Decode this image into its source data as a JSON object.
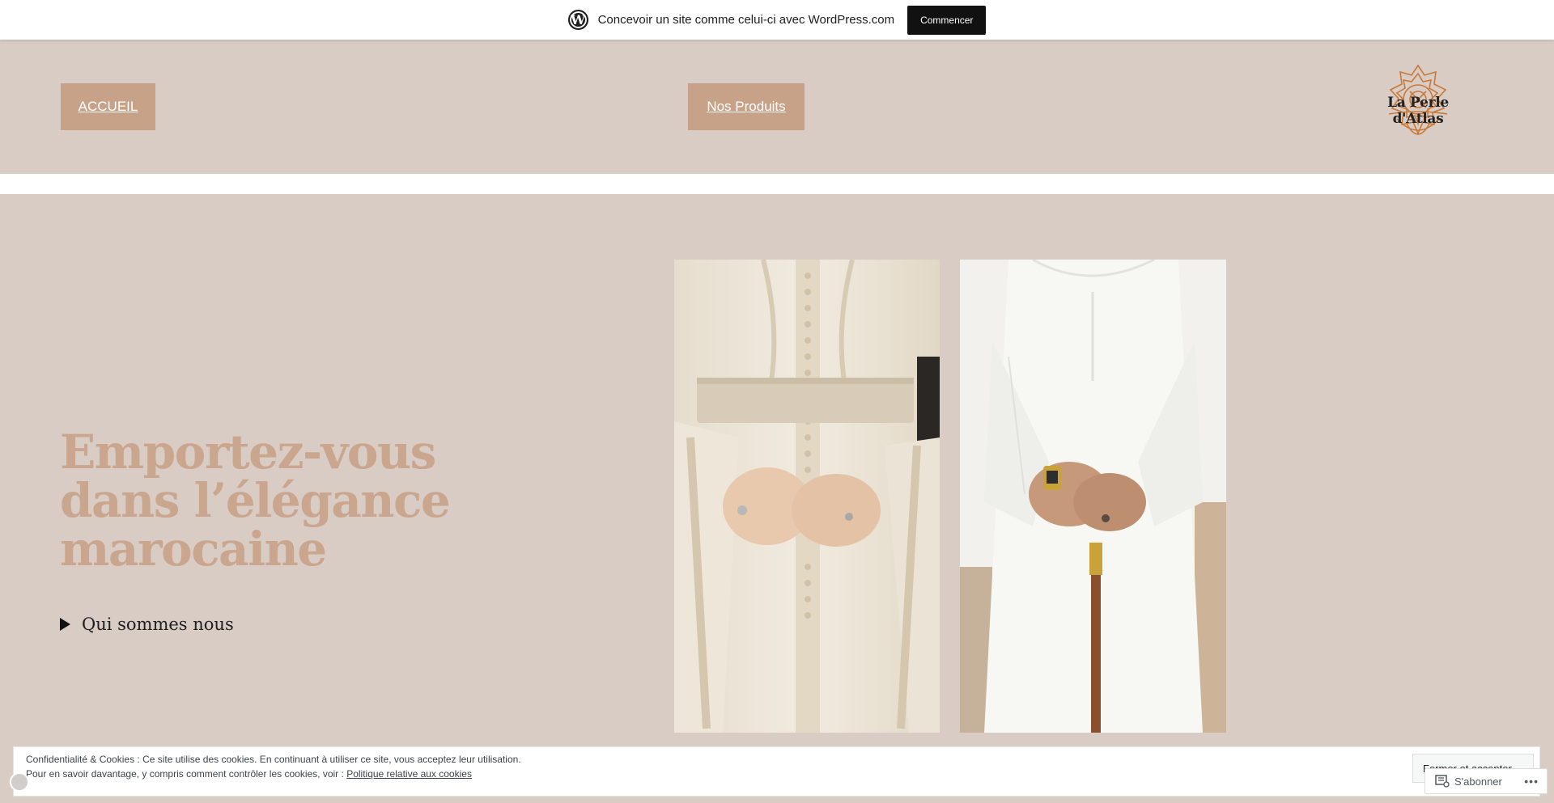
{
  "banner": {
    "text": "Concevoir un site comme celui-ci avec WordPress.com",
    "button": "Commencer",
    "logo_icon": "wordpress-logo-icon"
  },
  "nav": {
    "home": "ACCUEIL",
    "products": "Nos Produits"
  },
  "logo": {
    "text": "La Perle d'Atlas",
    "color": "#c7793b"
  },
  "hero": {
    "title": "Emportez-vous dans l’élégance marocaine",
    "details_label": "Qui sommes nous",
    "images": [
      {
        "name": "caftan-embroidered-photo"
      },
      {
        "name": "white-djellaba-cane-photo"
      }
    ]
  },
  "cookie": {
    "line1": "Confidentialité & Cookies : Ce site utilise des cookies. En continuant à utiliser ce site, vous acceptez leur utilisation.",
    "line2_prefix": "Pour en savoir davantage, y compris comment contrôler les cookies, voir :",
    "link": "Politique relative aux cookies",
    "close_button": "Fermer et accepter"
  },
  "subscribe": {
    "label": "S'abonner",
    "more": "•••"
  },
  "colors": {
    "background": "#d9ccc4",
    "accent": "#c8a288",
    "title": "#c9a68d"
  }
}
